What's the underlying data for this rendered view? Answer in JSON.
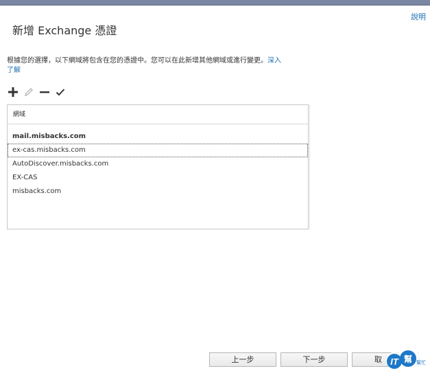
{
  "window": {
    "help_label": "說明"
  },
  "page": {
    "title": "新增 Exchange 憑證",
    "description_line": "根據您的選擇，以下網域將包含在您的憑證中。您可以在此新增其他網域或進行變更。",
    "learn_more_line1": "深入",
    "learn_more_line2": "了解"
  },
  "toolbar": {
    "icons": [
      "add-icon",
      "edit-icon",
      "remove-icon",
      "check-icon"
    ]
  },
  "domain_list": {
    "header": "網域",
    "items": [
      {
        "label": "mail.misbacks.com",
        "bold": true
      },
      {
        "label": "ex-cas.misbacks.com",
        "selected": true
      },
      {
        "label": "AutoDiscover.misbacks.com"
      },
      {
        "label": "EX-CAS"
      },
      {
        "label": "misbacks.com"
      }
    ]
  },
  "footer": {
    "back_label": "上一步",
    "next_label": "下一步",
    "cancel_label": "取"
  },
  "watermark": {
    "text_main": "IT",
    "text_side": "幫",
    "text_small": "幫忙"
  },
  "colors": {
    "link": "#1a6fb3",
    "top_bar": "#7a87a3",
    "watermark": "#1e78c8"
  }
}
